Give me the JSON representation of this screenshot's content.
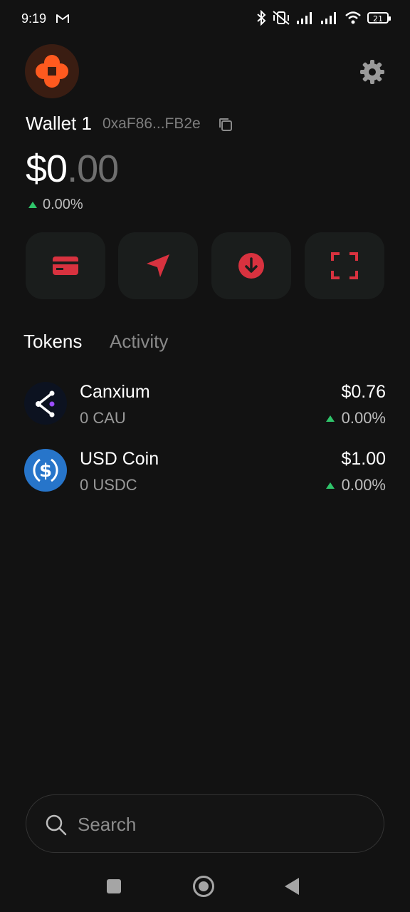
{
  "status_bar": {
    "time": "9:19",
    "battery": "21"
  },
  "wallet": {
    "name": "Wallet 1",
    "address": "0xaF86...FB2e",
    "balance_main": "$0",
    "balance_cents": ".00",
    "change": "0.00%"
  },
  "actions": [
    {
      "icon": "card-icon"
    },
    {
      "icon": "send-icon"
    },
    {
      "icon": "receive-icon"
    },
    {
      "icon": "scan-icon"
    }
  ],
  "tabs": [
    {
      "label": "Tokens",
      "active": true
    },
    {
      "label": "Activity",
      "active": false
    }
  ],
  "tokens": [
    {
      "name": "Canxium",
      "amount": "0 CAU",
      "price": "$0.76",
      "change": "0.00%"
    },
    {
      "name": "USD Coin",
      "amount": "0 USDC",
      "price": "$1.00",
      "change": "0.00%"
    }
  ],
  "search": {
    "placeholder": "Search"
  },
  "colors": {
    "background": "#121212",
    "accent_red": "#d8323f",
    "avatar_orange": "#ff5a1f",
    "positive_green": "#2fc46a",
    "usdc_blue": "#2775ca"
  }
}
